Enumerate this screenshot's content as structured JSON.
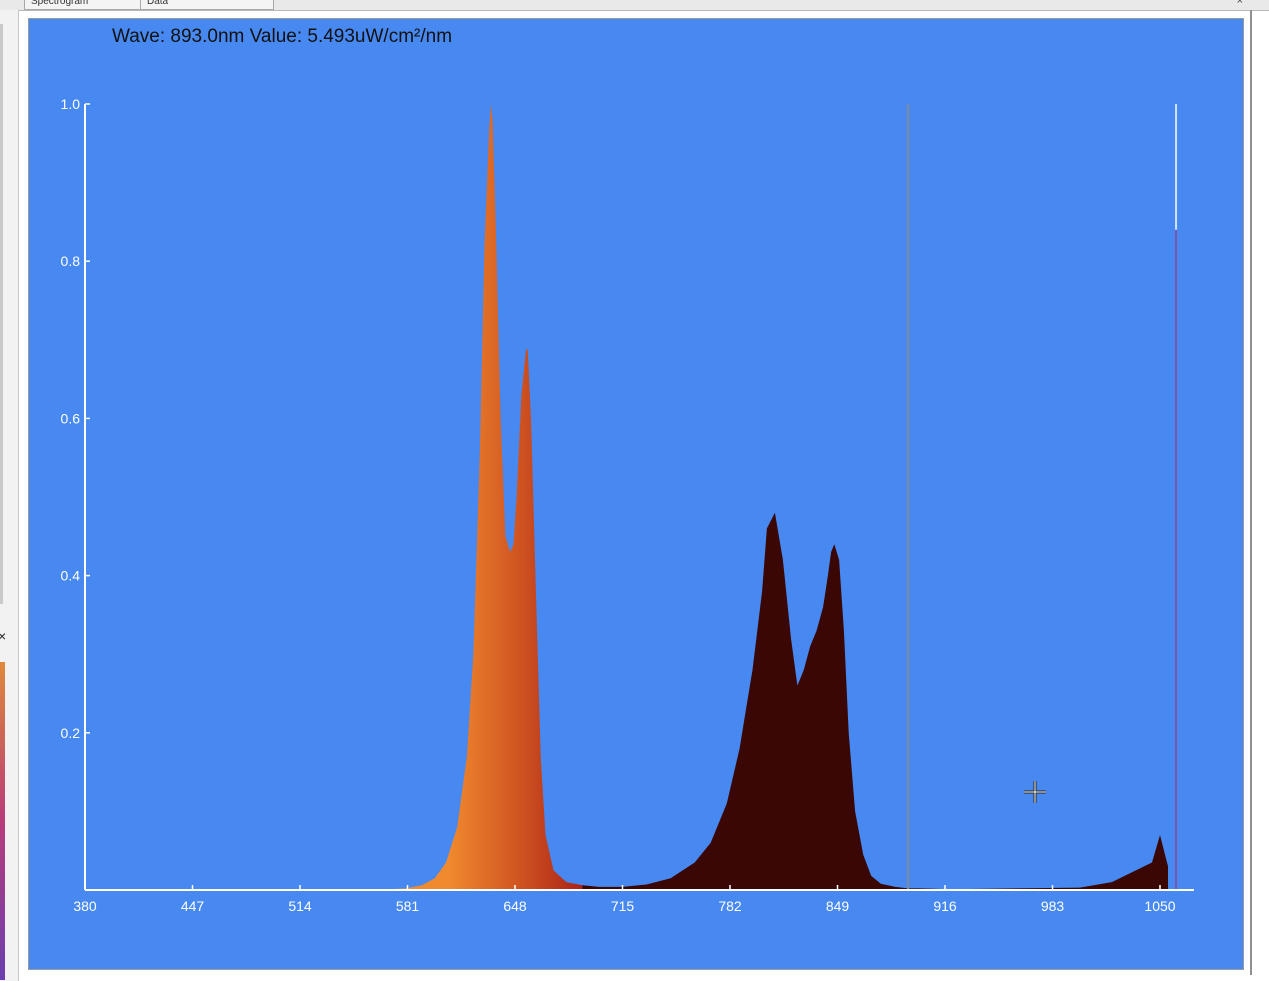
{
  "window": {
    "tabs": [
      {
        "label": "Spectrogram"
      },
      {
        "label": "Data"
      }
    ],
    "close_symbol": "×"
  },
  "left_panel": {
    "close_symbol": "×"
  },
  "readout": {
    "text": "Wave: 893.0nm Value: 5.493uW/cm²/nm"
  },
  "colors": {
    "plot_background": "#4789f0",
    "axis": "#ffffff",
    "peak_orange": "#e7792c",
    "peak_red": "#b0281a",
    "nir_fill": "#3a0704"
  },
  "chart_data": {
    "type": "area",
    "title": "",
    "xlabel": "",
    "ylabel": "",
    "xlim": [
      380,
      1060
    ],
    "ylim": [
      0,
      1.0
    ],
    "x_ticks": [
      380,
      447,
      514,
      581,
      648,
      715,
      782,
      849,
      916,
      983,
      1050
    ],
    "y_ticks": [
      0.2,
      0.4,
      0.6,
      0.8,
      1.0
    ],
    "y_tick_labels": [
      "0.2",
      "0.4",
      "0.6",
      "0.8",
      "1.0"
    ],
    "grid": false,
    "cursor_wavelength": 893.0,
    "series": [
      {
        "x": [
          380,
          560,
          580,
          590,
          598,
          605,
          612,
          618,
          622,
          626,
          629,
          632,
          633,
          634,
          636,
          639,
          642,
          645,
          647,
          649,
          652,
          655,
          656,
          658,
          661,
          664,
          667,
          672,
          680,
          690,
          700,
          715,
          730,
          745,
          760,
          770,
          780,
          788,
          792,
          796,
          799,
          802,
          805,
          810,
          815,
          820,
          824,
          828,
          832,
          836,
          840,
          843,
          845,
          847,
          850,
          853,
          856,
          860,
          865,
          870,
          876,
          885,
          893,
          900,
          920,
          960,
          1000,
          1020,
          1030,
          1035,
          1040,
          1045,
          1050,
          1055
        ],
        "values": [
          0,
          0,
          0.002,
          0.006,
          0.015,
          0.035,
          0.08,
          0.17,
          0.3,
          0.55,
          0.82,
          0.97,
          1.0,
          0.98,
          0.85,
          0.6,
          0.45,
          0.43,
          0.44,
          0.5,
          0.63,
          0.69,
          0.685,
          0.6,
          0.38,
          0.17,
          0.07,
          0.025,
          0.01,
          0.006,
          0.004,
          0.004,
          0.007,
          0.015,
          0.035,
          0.06,
          0.11,
          0.18,
          0.23,
          0.28,
          0.33,
          0.38,
          0.46,
          0.48,
          0.42,
          0.32,
          0.26,
          0.28,
          0.31,
          0.33,
          0.36,
          0.4,
          0.43,
          0.44,
          0.42,
          0.33,
          0.2,
          0.1,
          0.045,
          0.018,
          0.008,
          0.004,
          0.002,
          0.002,
          0.001,
          0.002,
          0.003,
          0.01,
          0.02,
          0.025,
          0.03,
          0.035,
          0.07,
          0.03
        ]
      }
    ]
  }
}
